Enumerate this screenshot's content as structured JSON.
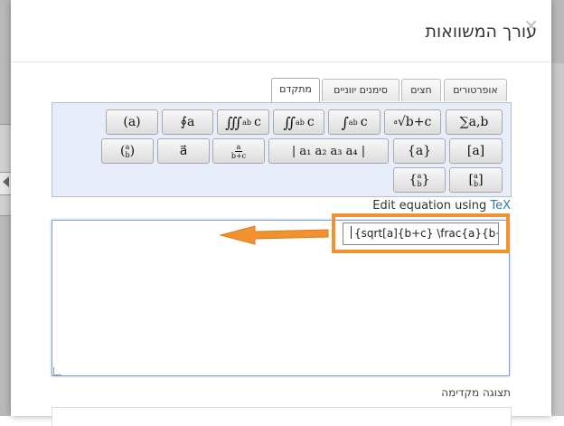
{
  "dialog": {
    "title": "עורך המשוואות",
    "close_glyph": "×"
  },
  "tabs": [
    {
      "label": "אופרטורים",
      "active": false
    },
    {
      "label": "חצים",
      "active": false
    },
    {
      "label": "סימנים יווניים",
      "active": false
    },
    {
      "label": "מתקדם",
      "active": true
    }
  ],
  "symbols": {
    "sum": "∑a,b",
    "sqrt": "√b+c",
    "sqrt_index": "a",
    "integral": "∫",
    "double_integral": "∬",
    "triple_integral": "∭",
    "contour_integral": "∮a",
    "paren": "(a)",
    "brackets": "[a]",
    "braces": "{a}",
    "matrix_row": "| a₁  a₂ a₃  a₄ |",
    "vector": "a⃗",
    "binom_top": "a",
    "binom_bottom": "b",
    "frac_num": "a",
    "frac_den": "b+c",
    "int_var": "c",
    "sub": "a",
    "sup": "b"
  },
  "tex": {
    "label": "Edit equation using",
    "link": "TeX"
  },
  "editor": {
    "value": ""
  },
  "callout": {
    "code": "{sqrt[a]{b+c} \\frac{a}{b+c\\"
  },
  "preview": {
    "label": "תצוגה מקדימה"
  },
  "colors": {
    "arrow": "#f1922e",
    "toolbar_bg": "#e7eefa",
    "link": "#2a7ab7"
  }
}
